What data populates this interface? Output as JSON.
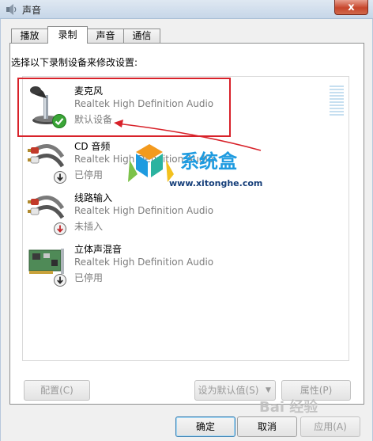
{
  "window": {
    "title": "声音",
    "close_label": "x"
  },
  "tabs": [
    {
      "label": "播放",
      "active": false
    },
    {
      "label": "录制",
      "active": true
    },
    {
      "label": "声音",
      "active": false
    },
    {
      "label": "通信",
      "active": false
    }
  ],
  "panel": {
    "instruction": "选择以下录制设备来修改设置:"
  },
  "devices": [
    {
      "name": "麦克风",
      "driver": "Realtek High Definition Audio",
      "status": "默认设备",
      "icon": "microphone-icon",
      "badge": "check-badge"
    },
    {
      "name": "CD 音频",
      "driver": "Realtek High Definition Audio",
      "status": "已停用",
      "icon": "audio-cable-icon",
      "badge": "down-arrow-badge"
    },
    {
      "name": "线路输入",
      "driver": "Realtek High Definition Audio",
      "status": "未插入",
      "icon": "audio-cable-icon",
      "badge": "down-arrow-badge"
    },
    {
      "name": "立体声混音",
      "driver": "Realtek High Definition Audio",
      "status": "已停用",
      "icon": "sound-card-icon",
      "badge": "down-arrow-badge"
    }
  ],
  "buttons": {
    "configure": "配置(C)",
    "set_default": "设为默认值(S)",
    "properties": "属性(P)",
    "ok": "确定",
    "cancel": "取消",
    "apply": "应用(A)"
  },
  "watermark": {
    "brand": "系统盒",
    "url": "www.xitonghe.com",
    "baidu": "Bai 经验"
  },
  "colors": {
    "highlight": "#d8222a",
    "accent": "#1e9be0",
    "status_text": "#7d7d7d"
  }
}
